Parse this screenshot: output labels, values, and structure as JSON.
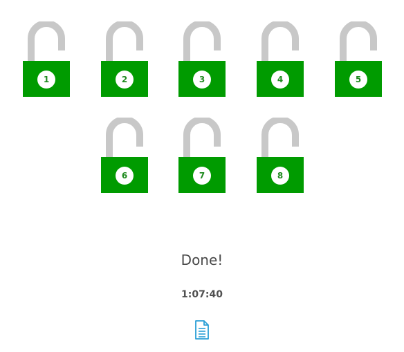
{
  "locks": [
    {
      "number": "1",
      "state": "unlocked"
    },
    {
      "number": "2",
      "state": "unlocked"
    },
    {
      "number": "3",
      "state": "unlocked"
    },
    {
      "number": "4",
      "state": "unlocked"
    },
    {
      "number": "5",
      "state": "unlocked"
    },
    {
      "number": "6",
      "state": "unlocked"
    },
    {
      "number": "7",
      "state": "unlocked"
    },
    {
      "number": "8",
      "state": "unlocked"
    }
  ],
  "status": {
    "message": "Done!",
    "time": "1:07:40"
  },
  "actions": {
    "report_icon": "document-icon"
  },
  "colors": {
    "lock_body": "#009b00",
    "shackle": "#c8c8c8",
    "number_circle": "#ffffff",
    "number_text": "#1f8a1f",
    "document_icon": "#2a9fd6"
  }
}
